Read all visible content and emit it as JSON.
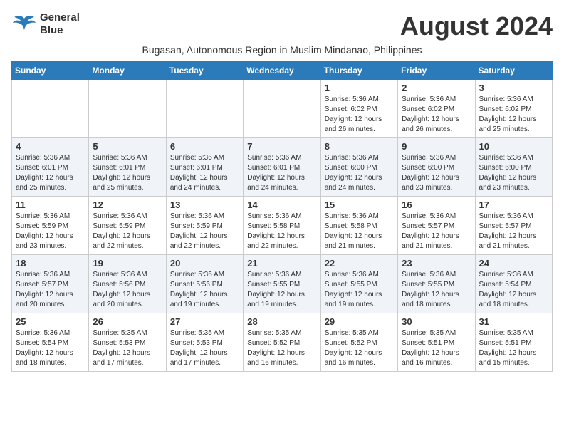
{
  "header": {
    "logo_line1": "General",
    "logo_line2": "Blue",
    "title": "August 2024",
    "subtitle": "Bugasan, Autonomous Region in Muslim Mindanao, Philippines"
  },
  "weekdays": [
    "Sunday",
    "Monday",
    "Tuesday",
    "Wednesday",
    "Thursday",
    "Friday",
    "Saturday"
  ],
  "weeks": [
    [
      {
        "day": "",
        "info": ""
      },
      {
        "day": "",
        "info": ""
      },
      {
        "day": "",
        "info": ""
      },
      {
        "day": "",
        "info": ""
      },
      {
        "day": "1",
        "info": "Sunrise: 5:36 AM\nSunset: 6:02 PM\nDaylight: 12 hours\nand 26 minutes."
      },
      {
        "day": "2",
        "info": "Sunrise: 5:36 AM\nSunset: 6:02 PM\nDaylight: 12 hours\nand 26 minutes."
      },
      {
        "day": "3",
        "info": "Sunrise: 5:36 AM\nSunset: 6:02 PM\nDaylight: 12 hours\nand 25 minutes."
      }
    ],
    [
      {
        "day": "4",
        "info": "Sunrise: 5:36 AM\nSunset: 6:01 PM\nDaylight: 12 hours\nand 25 minutes."
      },
      {
        "day": "5",
        "info": "Sunrise: 5:36 AM\nSunset: 6:01 PM\nDaylight: 12 hours\nand 25 minutes."
      },
      {
        "day": "6",
        "info": "Sunrise: 5:36 AM\nSunset: 6:01 PM\nDaylight: 12 hours\nand 24 minutes."
      },
      {
        "day": "7",
        "info": "Sunrise: 5:36 AM\nSunset: 6:01 PM\nDaylight: 12 hours\nand 24 minutes."
      },
      {
        "day": "8",
        "info": "Sunrise: 5:36 AM\nSunset: 6:00 PM\nDaylight: 12 hours\nand 24 minutes."
      },
      {
        "day": "9",
        "info": "Sunrise: 5:36 AM\nSunset: 6:00 PM\nDaylight: 12 hours\nand 23 minutes."
      },
      {
        "day": "10",
        "info": "Sunrise: 5:36 AM\nSunset: 6:00 PM\nDaylight: 12 hours\nand 23 minutes."
      }
    ],
    [
      {
        "day": "11",
        "info": "Sunrise: 5:36 AM\nSunset: 5:59 PM\nDaylight: 12 hours\nand 23 minutes."
      },
      {
        "day": "12",
        "info": "Sunrise: 5:36 AM\nSunset: 5:59 PM\nDaylight: 12 hours\nand 22 minutes."
      },
      {
        "day": "13",
        "info": "Sunrise: 5:36 AM\nSunset: 5:59 PM\nDaylight: 12 hours\nand 22 minutes."
      },
      {
        "day": "14",
        "info": "Sunrise: 5:36 AM\nSunset: 5:58 PM\nDaylight: 12 hours\nand 22 minutes."
      },
      {
        "day": "15",
        "info": "Sunrise: 5:36 AM\nSunset: 5:58 PM\nDaylight: 12 hours\nand 21 minutes."
      },
      {
        "day": "16",
        "info": "Sunrise: 5:36 AM\nSunset: 5:57 PM\nDaylight: 12 hours\nand 21 minutes."
      },
      {
        "day": "17",
        "info": "Sunrise: 5:36 AM\nSunset: 5:57 PM\nDaylight: 12 hours\nand 21 minutes."
      }
    ],
    [
      {
        "day": "18",
        "info": "Sunrise: 5:36 AM\nSunset: 5:57 PM\nDaylight: 12 hours\nand 20 minutes."
      },
      {
        "day": "19",
        "info": "Sunrise: 5:36 AM\nSunset: 5:56 PM\nDaylight: 12 hours\nand 20 minutes."
      },
      {
        "day": "20",
        "info": "Sunrise: 5:36 AM\nSunset: 5:56 PM\nDaylight: 12 hours\nand 19 minutes."
      },
      {
        "day": "21",
        "info": "Sunrise: 5:36 AM\nSunset: 5:55 PM\nDaylight: 12 hours\nand 19 minutes."
      },
      {
        "day": "22",
        "info": "Sunrise: 5:36 AM\nSunset: 5:55 PM\nDaylight: 12 hours\nand 19 minutes."
      },
      {
        "day": "23",
        "info": "Sunrise: 5:36 AM\nSunset: 5:55 PM\nDaylight: 12 hours\nand 18 minutes."
      },
      {
        "day": "24",
        "info": "Sunrise: 5:36 AM\nSunset: 5:54 PM\nDaylight: 12 hours\nand 18 minutes."
      }
    ],
    [
      {
        "day": "25",
        "info": "Sunrise: 5:36 AM\nSunset: 5:54 PM\nDaylight: 12 hours\nand 18 minutes."
      },
      {
        "day": "26",
        "info": "Sunrise: 5:35 AM\nSunset: 5:53 PM\nDaylight: 12 hours\nand 17 minutes."
      },
      {
        "day": "27",
        "info": "Sunrise: 5:35 AM\nSunset: 5:53 PM\nDaylight: 12 hours\nand 17 minutes."
      },
      {
        "day": "28",
        "info": "Sunrise: 5:35 AM\nSunset: 5:52 PM\nDaylight: 12 hours\nand 16 minutes."
      },
      {
        "day": "29",
        "info": "Sunrise: 5:35 AM\nSunset: 5:52 PM\nDaylight: 12 hours\nand 16 minutes."
      },
      {
        "day": "30",
        "info": "Sunrise: 5:35 AM\nSunset: 5:51 PM\nDaylight: 12 hours\nand 16 minutes."
      },
      {
        "day": "31",
        "info": "Sunrise: 5:35 AM\nSunset: 5:51 PM\nDaylight: 12 hours\nand 15 minutes."
      }
    ]
  ]
}
